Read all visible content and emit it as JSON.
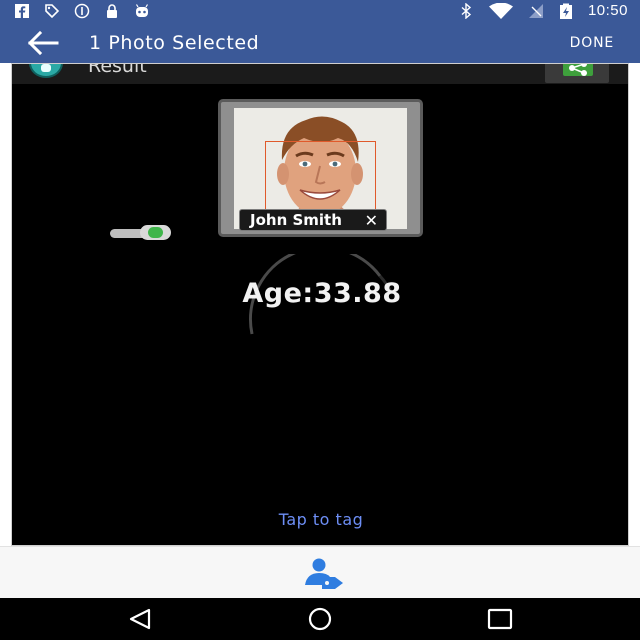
{
  "status_bar": {
    "time": "10:50",
    "left_icons": [
      "facebook-icon",
      "tags-icon",
      "info-icon",
      "lock-icon",
      "android-icon"
    ],
    "right_icons": [
      "bluetooth-icon",
      "wifi-icon",
      "signal-icon",
      "battery-icon"
    ]
  },
  "app_bar": {
    "back_icon": "arrow-back-icon",
    "title": "1 Photo Selected",
    "done_label": "DONE",
    "background": "#3b5998"
  },
  "result_header": {
    "label": "Result",
    "share_icon": "share-icon"
  },
  "photo": {
    "name_tag": "John Smith",
    "close_icon": "close-icon"
  },
  "toggle": {
    "state": "on",
    "accent": "#3fb54a"
  },
  "age_result": "Age:33.88",
  "tap_to_tag": "Tap to tag",
  "bottom_toolbar": {
    "tag_person_icon": "tag-person-icon"
  },
  "nav_bar": {
    "back_icon": "nav-back-icon",
    "home_icon": "nav-home-icon",
    "recents_icon": "nav-recents-icon"
  }
}
